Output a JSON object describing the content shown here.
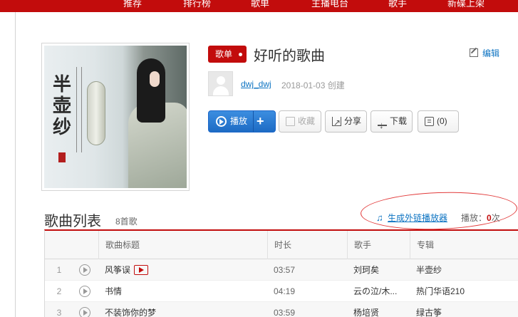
{
  "nav": {
    "items": [
      "推荐",
      "排行榜",
      "歌单",
      "主播电台",
      "歌手",
      "新碟上架"
    ]
  },
  "playlist": {
    "tag": "歌单",
    "title": "好听的歌曲",
    "edit_label": "编辑",
    "cover_text": "半壶纱",
    "user": "dwj_dwj",
    "created": "2018-01-03 创建"
  },
  "actions": {
    "play": "播放",
    "add": "+",
    "collect": "收藏",
    "share": "分享",
    "download": "下载",
    "comment": "(0)"
  },
  "songlist": {
    "title": "歌曲列表",
    "count": "8首歌",
    "outchain": "生成外链播放器",
    "play_label": "播放：",
    "play_count": "0",
    "play_unit": "次",
    "headers": [
      "歌曲标题",
      "时长",
      "歌手",
      "专辑"
    ],
    "rows": [
      {
        "idx": "1",
        "title": "风筝误",
        "dur": "03:57",
        "artist": "刘珂矣",
        "album": "半壶纱"
      },
      {
        "idx": "2",
        "title": "书情",
        "dur": "04:19",
        "artist": "云の泣/木...",
        "album": "热门华语210"
      },
      {
        "idx": "3",
        "title": "不装饰你的梦",
        "dur": "03:59",
        "artist": "杨培贤",
        "album": "绿古筝"
      }
    ]
  },
  "colors": {
    "brand_red": "#c20c0c",
    "link_blue": "#0c73c2",
    "play_blue": "#1d6bc4"
  }
}
